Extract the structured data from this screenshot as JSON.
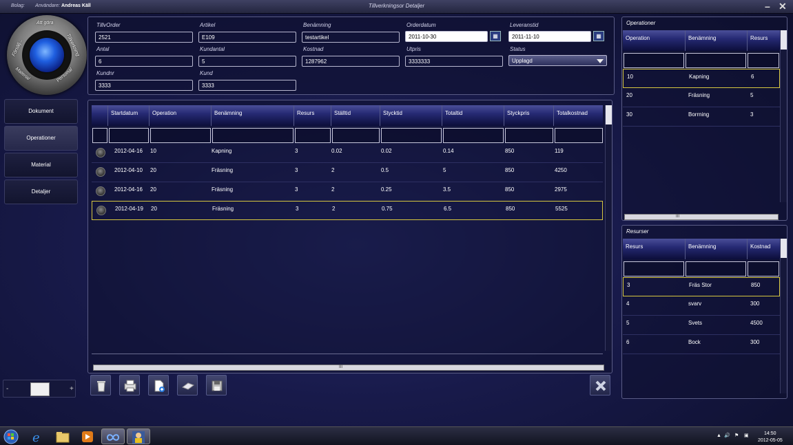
{
  "titlebar": {
    "bolag_label": "Bolag:",
    "user_label": "Användare:",
    "user_name": "Andreas Käll",
    "title": "Tillverkningsor Detaljer",
    "minimize": "–",
    "close": "✕"
  },
  "dial": {
    "top": "Att göra",
    "left": "Försälj...",
    "right": "Tillverkning",
    "bottom_left": "Material",
    "bottom_right": "Personal"
  },
  "nav": {
    "items": [
      {
        "label": "Dokument"
      },
      {
        "label": "Operationer"
      },
      {
        "label": "Material"
      },
      {
        "label": "Detaljer"
      }
    ]
  },
  "zoom": {
    "minus": "-",
    "plus": "+"
  },
  "form": {
    "tillvorder_label": "TillvOrder",
    "tillvorder": "2521",
    "artikel_label": "Artikel",
    "artikel": "E109",
    "benamning_label": "Benämning",
    "benamning": "testartikel",
    "orderdatum_label": "Orderdatum",
    "orderdatum": "2011-10-30",
    "leveranstid_label": "Leveranstid",
    "leveranstid": "2011-11-10",
    "antal_label": "Antal",
    "antal": "6",
    "kundantal_label": "Kundantal",
    "kundantal": "5",
    "kostnad_label": "Kostnad",
    "kostnad": "1287962",
    "utpris_label": "Utpris",
    "utpris": "3333333",
    "status_label": "Status",
    "status": "Upplagd",
    "kundnr_label": "Kundnr",
    "kundnr": "3333",
    "kund_label": "Kund",
    "kund": "3333"
  },
  "grid": {
    "columns": [
      "Startdatum",
      "Operation",
      "Benämning",
      "Resurs",
      "Ställtid",
      "Stycktid",
      "Totaltid",
      "Styckpris",
      "Totalkostnad"
    ],
    "rows": [
      [
        "2012-04-16",
        "10",
        "Kapning",
        "3",
        "0.02",
        "0.02",
        "0.14",
        "850",
        "119"
      ],
      [
        "2012-04-10",
        "20",
        "Fräsning",
        "3",
        "2",
        "0.5",
        "5",
        "850",
        "4250"
      ],
      [
        "2012-04-16",
        "20",
        "Fräsning",
        "3",
        "2",
        "0.25",
        "3.5",
        "850",
        "2975"
      ],
      [
        "2012-04-19",
        "20",
        "Fräsning",
        "3",
        "2",
        "0.75",
        "6.5",
        "850",
        "5525"
      ]
    ],
    "hscroll_grip": "III"
  },
  "operationer": {
    "title": "Operationer",
    "columns": [
      "Operation",
      "Benämning",
      "Resurs"
    ],
    "rows": [
      [
        "10",
        "Kapning",
        "6"
      ],
      [
        "20",
        "Fräsning",
        "5"
      ],
      [
        "30",
        "Borrning",
        "3"
      ]
    ],
    "hscroll_grip": "III"
  },
  "resurser": {
    "title": "Resurser",
    "columns": [
      "Resurs",
      "Benämning",
      "Kostnad"
    ],
    "rows": [
      [
        "3",
        "Fräs Stor",
        "850"
      ],
      [
        "4",
        "svarv",
        "300"
      ],
      [
        "5",
        "Svets",
        "4500"
      ],
      [
        "6",
        "Bock",
        "300"
      ]
    ]
  },
  "toolbar": {
    "icons": [
      "trash-icon",
      "print-icon",
      "new-document-icon",
      "eraser-icon",
      "save-icon",
      "close-icon"
    ]
  },
  "tray": {
    "time": "14:50",
    "date": "2012-05-05"
  }
}
